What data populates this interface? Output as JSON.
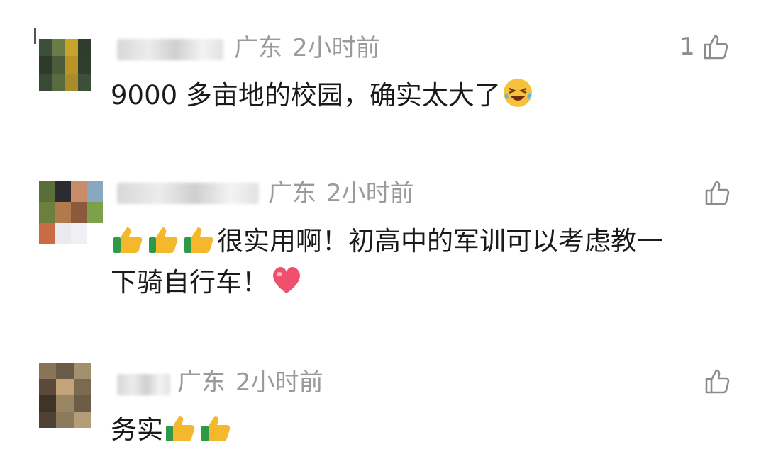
{
  "comments": [
    {
      "region": "广东",
      "time": "2小时前",
      "likes": "1",
      "line1": "9000 多亩地的校园，确实太大了",
      "emoji": "grinning-squinting-face-with-tears-emoji",
      "avatar_colors": [
        "#3b4f3d",
        "#6a7b48",
        "#c9a42b",
        "#2f3d2c",
        "#2e3b2a",
        "#4b5c3a",
        "#b89426",
        "#303f2b",
        "#384a35",
        "#566b3f",
        "#a88d2a",
        "#3c4f38"
      ]
    },
    {
      "region": "广东",
      "time": "2小时前",
      "likes": "",
      "line1": "很实用啊！初高中的军训可以考虑教一",
      "line2": "下骑自行车！",
      "emoji_prefix": [
        "thumbs-up-emoji",
        "thumbs-up-emoji",
        "thumbs-up-emoji"
      ],
      "emoji_suffix": "red-heart-emoji",
      "avatar_colors": [
        "#5a6e3a",
        "#2b2b30",
        "#c98c6a",
        "#8aa7c2",
        "#6d7f3e",
        "#b07a4c",
        "#8a5a3c",
        "#7da04a",
        "#c96b45",
        "#e9e9ee",
        "#f0f0f4",
        "#ffffff"
      ]
    },
    {
      "region": "广东",
      "time": "2小时前",
      "likes": "",
      "line1": "务实",
      "emoji_suffix": [
        "thumbs-up-emoji",
        "thumbs-up-emoji"
      ],
      "avatar_colors": [
        "#8a7458",
        "#6a5a48",
        "#a3906f",
        "#5b4a3a",
        "#c5a37a",
        "#7a6a50",
        "#3e3428",
        "#9b8664",
        "#6e5d46",
        "#4f4232",
        "#8c7a5c",
        "#b39c78"
      ]
    }
  ]
}
